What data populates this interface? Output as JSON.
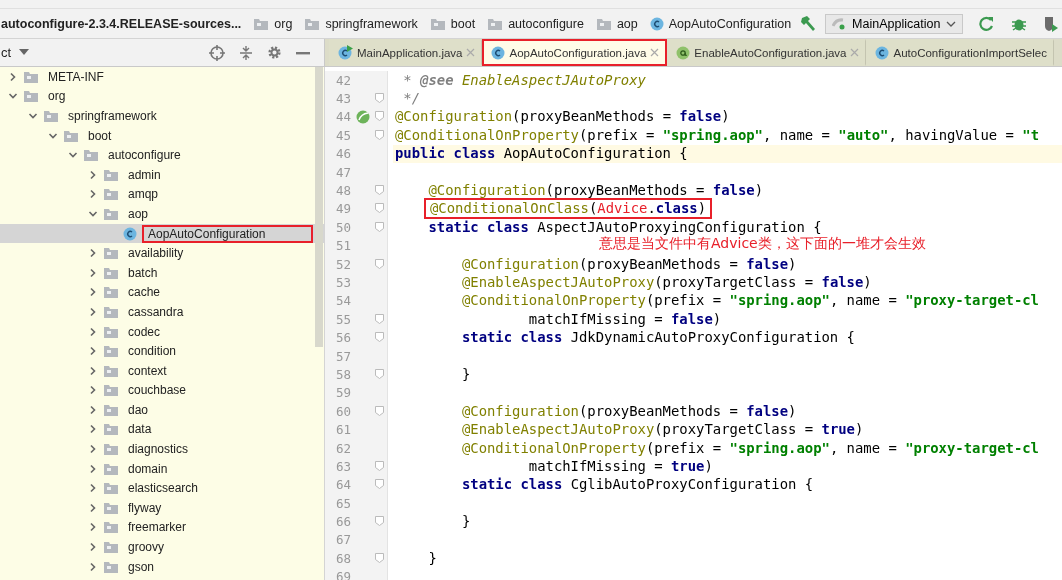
{
  "breadcrumb": {
    "project": "autoconfigure-2.3.4.RELEASE-sources...",
    "items": [
      {
        "label": "org",
        "kind": "folder"
      },
      {
        "label": "springframework",
        "kind": "folder"
      },
      {
        "label": "boot",
        "kind": "folder"
      },
      {
        "label": "autoconfigure",
        "kind": "folder"
      },
      {
        "label": "aop",
        "kind": "folder"
      },
      {
        "label": "AopAutoConfiguration",
        "kind": "class"
      }
    ]
  },
  "run_config": {
    "label": "MainApplication"
  },
  "project_panel": {
    "title": "ct"
  },
  "tabs": [
    {
      "label": "MainApplication.java",
      "kind": "runnable-class",
      "selected": false,
      "boxed": false
    },
    {
      "label": "AopAutoConfiguration.java",
      "kind": "class",
      "selected": true,
      "boxed": true
    },
    {
      "label": "EnableAutoConfiguration.java",
      "kind": "annotation",
      "selected": false,
      "boxed": false
    },
    {
      "label": "AutoConfigurationImportSelec",
      "kind": "class",
      "selected": false,
      "boxed": false
    }
  ],
  "tree": [
    {
      "label": "META-INF",
      "kind": "folder",
      "expanded": false,
      "selected": false,
      "boxed": false
    },
    {
      "label": "org",
      "kind": "folder",
      "expanded": true,
      "selected": false,
      "boxed": false,
      "children": [
        {
          "label": "springframework",
          "kind": "folder",
          "expanded": true,
          "selected": false,
          "boxed": false,
          "children": [
            {
              "label": "boot",
              "kind": "folder",
              "expanded": true,
              "selected": false,
              "boxed": false,
              "children": [
                {
                  "label": "autoconfigure",
                  "kind": "folder",
                  "expanded": true,
                  "selected": false,
                  "boxed": false,
                  "children": [
                    {
                      "label": "admin",
                      "kind": "folder",
                      "expanded": false,
                      "selected": false,
                      "boxed": false
                    },
                    {
                      "label": "amqp",
                      "kind": "folder",
                      "expanded": false,
                      "selected": false,
                      "boxed": false
                    },
                    {
                      "label": "aop",
                      "kind": "folder",
                      "expanded": true,
                      "selected": false,
                      "boxed": false,
                      "children": [
                        {
                          "label": "AopAutoConfiguration",
                          "kind": "class",
                          "selected": true,
                          "boxed": true
                        }
                      ]
                    },
                    {
                      "label": "availability",
                      "kind": "folder",
                      "expanded": false,
                      "selected": false,
                      "boxed": false
                    },
                    {
                      "label": "batch",
                      "kind": "folder",
                      "expanded": false,
                      "selected": false,
                      "boxed": false
                    },
                    {
                      "label": "cache",
                      "kind": "folder",
                      "expanded": false,
                      "selected": false,
                      "boxed": false
                    },
                    {
                      "label": "cassandra",
                      "kind": "folder",
                      "expanded": false,
                      "selected": false,
                      "boxed": false
                    },
                    {
                      "label": "codec",
                      "kind": "folder",
                      "expanded": false,
                      "selected": false,
                      "boxed": false
                    },
                    {
                      "label": "condition",
                      "kind": "folder",
                      "expanded": false,
                      "selected": false,
                      "boxed": false
                    },
                    {
                      "label": "context",
                      "kind": "folder",
                      "expanded": false,
                      "selected": false,
                      "boxed": false
                    },
                    {
                      "label": "couchbase",
                      "kind": "folder",
                      "expanded": false,
                      "selected": false,
                      "boxed": false
                    },
                    {
                      "label": "dao",
                      "kind": "folder",
                      "expanded": false,
                      "selected": false,
                      "boxed": false
                    },
                    {
                      "label": "data",
                      "kind": "folder",
                      "expanded": false,
                      "selected": false,
                      "boxed": false
                    },
                    {
                      "label": "diagnostics",
                      "kind": "folder",
                      "expanded": false,
                      "selected": false,
                      "boxed": false
                    },
                    {
                      "label": "domain",
                      "kind": "folder",
                      "expanded": false,
                      "selected": false,
                      "boxed": false
                    },
                    {
                      "label": "elasticsearch",
                      "kind": "folder",
                      "expanded": false,
                      "selected": false,
                      "boxed": false
                    },
                    {
                      "label": "flyway",
                      "kind": "folder",
                      "expanded": false,
                      "selected": false,
                      "boxed": false
                    },
                    {
                      "label": "freemarker",
                      "kind": "folder",
                      "expanded": false,
                      "selected": false,
                      "boxed": false
                    },
                    {
                      "label": "groovy",
                      "kind": "folder",
                      "expanded": false,
                      "selected": false,
                      "boxed": false
                    },
                    {
                      "label": "gson",
                      "kind": "folder",
                      "expanded": false,
                      "selected": false,
                      "boxed": false
                    }
                  ]
                }
              ]
            }
          ]
        }
      ]
    }
  ],
  "code": [
    {
      "number": "42",
      "current": false,
      "fold": false,
      "marker": false,
      "tokens": [
        {
          "kind": "comment",
          "text": " * "
        },
        {
          "kind": "doctag",
          "text": "@see"
        },
        {
          "kind": "docref",
          "text": " EnableAspectJAutoProxy"
        }
      ]
    },
    {
      "number": "43",
      "current": false,
      "fold": true,
      "marker": false,
      "tokens": [
        {
          "kind": "comment",
          "text": " */"
        }
      ]
    },
    {
      "number": "44",
      "current": false,
      "fold": true,
      "marker": true,
      "tokens": [
        {
          "kind": "annotation",
          "text": "@Configuration"
        },
        {
          "kind": "plain",
          "text": "(proxyBeanMethods = "
        },
        {
          "kind": "keyword",
          "text": "false"
        },
        {
          "kind": "plain",
          "text": ")"
        }
      ]
    },
    {
      "number": "45",
      "current": false,
      "fold": true,
      "marker": false,
      "tokens": [
        {
          "kind": "annotation",
          "text": "@ConditionalOnProperty"
        },
        {
          "kind": "plain",
          "text": "(prefix = "
        },
        {
          "kind": "string",
          "text": "\"spring.aop\""
        },
        {
          "kind": "plain",
          "text": ", name = "
        },
        {
          "kind": "string",
          "text": "\"auto\""
        },
        {
          "kind": "plain",
          "text": ", havingValue = "
        },
        {
          "kind": "string",
          "text": "\"t"
        }
      ]
    },
    {
      "number": "46",
      "current": true,
      "fold": false,
      "marker": false,
      "tokens": [
        {
          "kind": "keyword",
          "text": "public class "
        },
        {
          "kind": "plain",
          "text": "AopAutoConfiguration {"
        }
      ]
    },
    {
      "number": "47",
      "current": false,
      "fold": false,
      "marker": false
    },
    {
      "number": "48",
      "current": false,
      "fold": true,
      "marker": false,
      "tokens": [
        {
          "kind": "annotation",
          "text": "    @Configuration"
        },
        {
          "kind": "plain",
          "text": "(proxyBeanMethods = "
        },
        {
          "kind": "keyword",
          "text": "false"
        },
        {
          "kind": "plain",
          "text": ")"
        }
      ]
    },
    {
      "number": "49",
      "current": false,
      "fold": true,
      "marker": false,
      "boxed": true,
      "tokens": [
        {
          "kind": "annotation",
          "text": "@ConditionalOnClass"
        },
        {
          "kind": "plain",
          "text": "("
        },
        {
          "kind": "error",
          "text": "Advice"
        },
        {
          "kind": "plain",
          "text": "."
        },
        {
          "kind": "keyword",
          "text": "class"
        },
        {
          "kind": "plain",
          "text": ")"
        }
      ]
    },
    {
      "number": "50",
      "current": false,
      "fold": true,
      "marker": false,
      "tokens": [
        {
          "kind": "keyword",
          "text": "    static class "
        },
        {
          "kind": "plain",
          "text": "AspectJAutoProxyingConfiguration {"
        }
      ]
    },
    {
      "number": "51",
      "current": false,
      "fold": false,
      "marker": false
    },
    {
      "number": "52",
      "current": false,
      "fold": true,
      "marker": false,
      "tokens": [
        {
          "kind": "annotation",
          "text": "        @Configuration"
        },
        {
          "kind": "plain",
          "text": "(proxyBeanMethods = "
        },
        {
          "kind": "keyword",
          "text": "false"
        },
        {
          "kind": "plain",
          "text": ")"
        }
      ]
    },
    {
      "number": "53",
      "current": false,
      "fold": false,
      "marker": false,
      "tokens": [
        {
          "kind": "annotation",
          "text": "        @EnableAspectJAutoProxy"
        },
        {
          "kind": "plain",
          "text": "(proxyTargetClass = "
        },
        {
          "kind": "keyword",
          "text": "false"
        },
        {
          "kind": "plain",
          "text": ")"
        }
      ]
    },
    {
      "number": "54",
      "current": false,
      "fold": false,
      "marker": false,
      "tokens": [
        {
          "kind": "annotation",
          "text": "        @ConditionalOnProperty"
        },
        {
          "kind": "plain",
          "text": "(prefix = "
        },
        {
          "kind": "string",
          "text": "\"spring.aop\""
        },
        {
          "kind": "plain",
          "text": ", name = "
        },
        {
          "kind": "string",
          "text": "\"proxy-target-cl"
        }
      ]
    },
    {
      "number": "55",
      "current": false,
      "fold": true,
      "marker": false,
      "tokens": [
        {
          "kind": "plain",
          "text": "                matchIfMissing = "
        },
        {
          "kind": "keyword",
          "text": "false"
        },
        {
          "kind": "plain",
          "text": ")"
        }
      ]
    },
    {
      "number": "56",
      "current": false,
      "fold": true,
      "marker": false,
      "tokens": [
        {
          "kind": "keyword",
          "text": "        static class "
        },
        {
          "kind": "plain",
          "text": "JdkDynamicAutoProxyConfiguration {"
        }
      ]
    },
    {
      "number": "57",
      "current": false,
      "fold": false,
      "marker": false
    },
    {
      "number": "58",
      "current": false,
      "fold": true,
      "marker": false,
      "tokens": [
        {
          "kind": "plain",
          "text": "        }"
        }
      ]
    },
    {
      "number": "59",
      "current": false,
      "fold": false,
      "marker": false
    },
    {
      "number": "60",
      "current": false,
      "fold": true,
      "marker": false,
      "tokens": [
        {
          "kind": "annotation",
          "text": "        @Configuration"
        },
        {
          "kind": "plain",
          "text": "(proxyBeanMethods = "
        },
        {
          "kind": "keyword",
          "text": "false"
        },
        {
          "kind": "plain",
          "text": ")"
        }
      ]
    },
    {
      "number": "61",
      "current": false,
      "fold": false,
      "marker": false,
      "tokens": [
        {
          "kind": "annotation",
          "text": "        @EnableAspectJAutoProxy"
        },
        {
          "kind": "plain",
          "text": "(proxyTargetClass = "
        },
        {
          "kind": "keyword",
          "text": "true"
        },
        {
          "kind": "plain",
          "text": ")"
        }
      ]
    },
    {
      "number": "62",
      "current": false,
      "fold": false,
      "marker": false,
      "tokens": [
        {
          "kind": "annotation",
          "text": "        @ConditionalOnProperty"
        },
        {
          "kind": "plain",
          "text": "(prefix = "
        },
        {
          "kind": "string",
          "text": "\"spring.aop\""
        },
        {
          "kind": "plain",
          "text": ", name = "
        },
        {
          "kind": "string",
          "text": "\"proxy-target-cl"
        }
      ]
    },
    {
      "number": "63",
      "current": false,
      "fold": true,
      "marker": false,
      "tokens": [
        {
          "kind": "plain",
          "text": "                matchIfMissing = "
        },
        {
          "kind": "keyword",
          "text": "true"
        },
        {
          "kind": "plain",
          "text": ")"
        }
      ]
    },
    {
      "number": "64",
      "current": false,
      "fold": true,
      "marker": false,
      "tokens": [
        {
          "kind": "keyword",
          "text": "        static class "
        },
        {
          "kind": "plain",
          "text": "CglibAutoProxyConfiguration {"
        }
      ]
    },
    {
      "number": "65",
      "current": false,
      "fold": false,
      "marker": false
    },
    {
      "number": "66",
      "current": false,
      "fold": true,
      "marker": false,
      "tokens": [
        {
          "kind": "plain",
          "text": "        }"
        }
      ]
    },
    {
      "number": "67",
      "current": false,
      "fold": false,
      "marker": false
    },
    {
      "number": "68",
      "current": false,
      "fold": true,
      "marker": false,
      "tokens": [
        {
          "kind": "plain",
          "text": "    }"
        }
      ]
    },
    {
      "number": "69",
      "current": false,
      "fold": false,
      "marker": false
    }
  ],
  "note": "意思是当文件中有Advice类，这下面的一堆才会生效"
}
